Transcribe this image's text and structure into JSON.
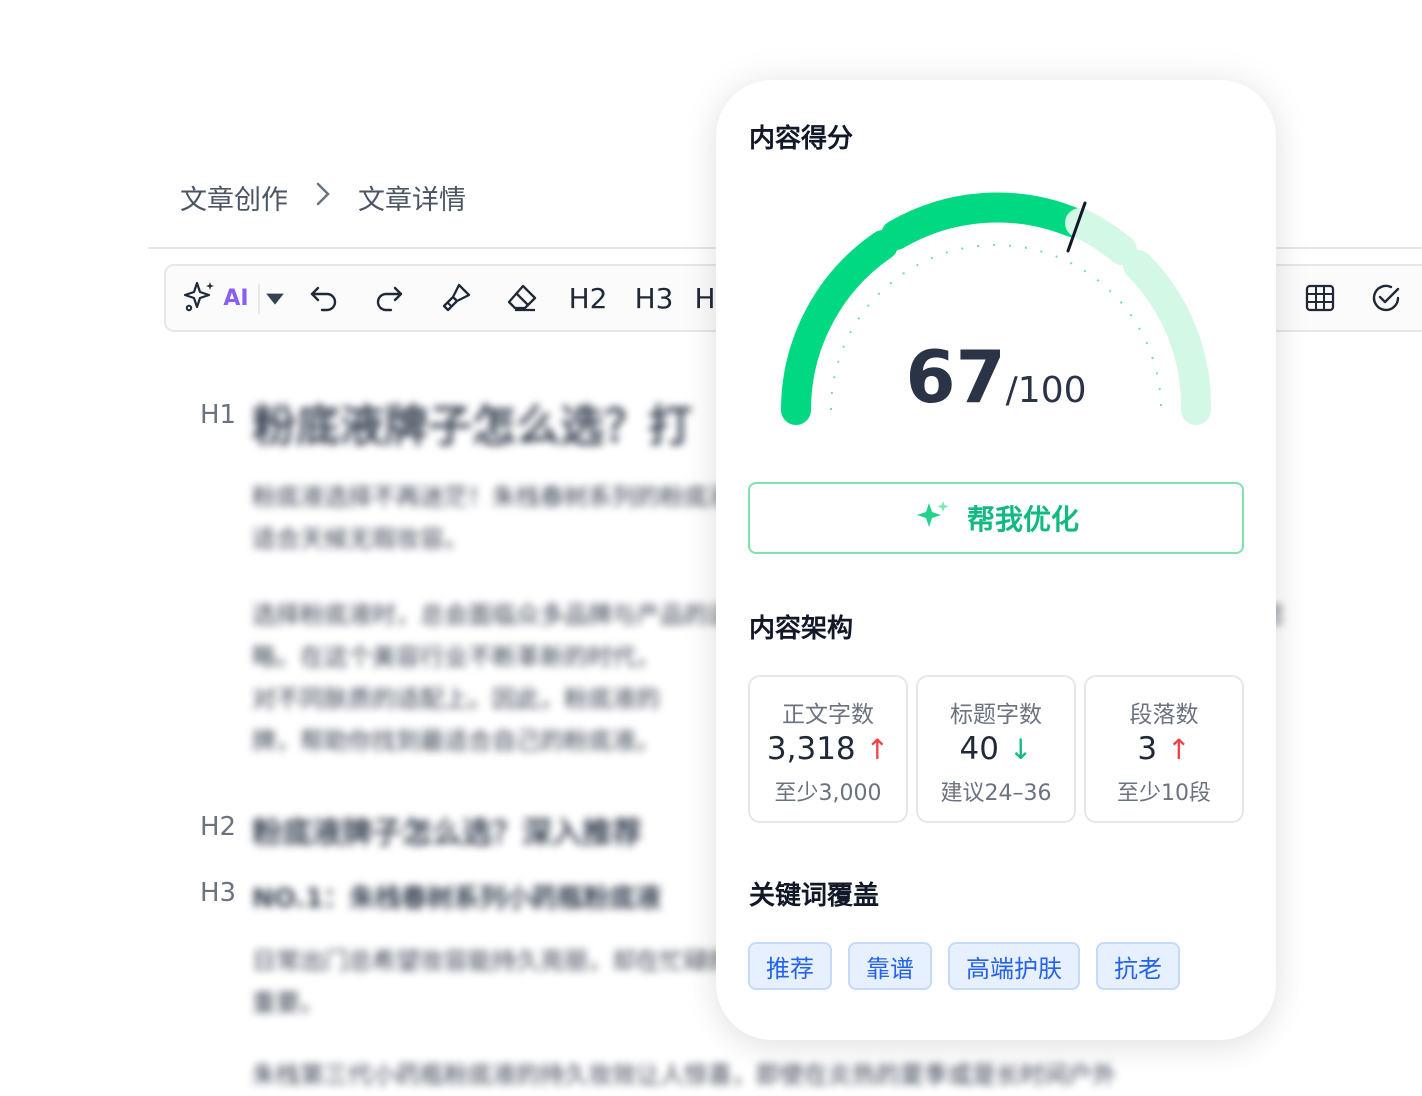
{
  "breadcrumb": {
    "parent": "文章创作",
    "current": "文章详情"
  },
  "toolbar": {
    "ai_label": "AI",
    "h2": "H2",
    "h3": "H3",
    "h4": "H",
    "icons": [
      "sparkle-icon",
      "dropdown-caret-icon",
      "undo-icon",
      "redo-icon",
      "format-painter-icon",
      "eraser-icon",
      "table-icon",
      "check-circle-icon"
    ]
  },
  "article": {
    "h1_mark": "H1",
    "title": "粉底液牌子怎么选？打",
    "para1": "粉底液选择不再迷茫！朱栈春树系列的粉底液，助你轻松打造完美底妆，让你的底妆服帖自然，",
    "para1b": "适合天候无瑕妆容。",
    "para2": "选择粉底液时，总会面临众多品牌与产品的选择，而一款好的粉底液能决定妆容的成败，更不能忽",
    "para2b": "略。在这个美容行业不断革新的时代，",
    "para2c": "对不同肤质的适配上。因此，粉底液的",
    "para2d": "牌，帮助你找到最适合自己的粉底液。",
    "h2_mark": "H2",
    "h2": "粉底液牌子怎么选？深入推荐",
    "h3_mark": "H3",
    "h3": "NO.1：朱栈春树系列小药瓶粉底液",
    "para3": "日常出门总希望妆容能持久亮丽，却在忙碌的一天中逐渐暗沉，",
    "para3b": "重要。",
    "para4": "朱栈第三代小药瓶粉底液的持久妆效让人惊喜，即使在炎热的夏季或是长时间户外"
  },
  "score_card": {
    "title": "内容得分",
    "score": "67",
    "total": "/100",
    "score_value": 67,
    "optimize_label": "帮我优化",
    "structure_title": "内容架构",
    "stats": [
      {
        "label": "正文字数",
        "value": "3,318",
        "trend": "↑",
        "hint": "至少3,000"
      },
      {
        "label": "标题字数",
        "value": "40",
        "trend": "↓",
        "hint": "建议24–36"
      },
      {
        "label": "段落数",
        "value": "3",
        "trend": "↑",
        "hint": "至少10段"
      }
    ],
    "keywords_title": "关键词覆盖",
    "keywords": [
      "推荐",
      "靠谱",
      "高端护肤",
      "抗老"
    ]
  },
  "colors": {
    "accent_green": "#00d982",
    "light_green": "#d3f8e6",
    "tag_blue": "#2563eb",
    "up_red": "#ef4444",
    "ai_purple": "#8b5cf6"
  }
}
